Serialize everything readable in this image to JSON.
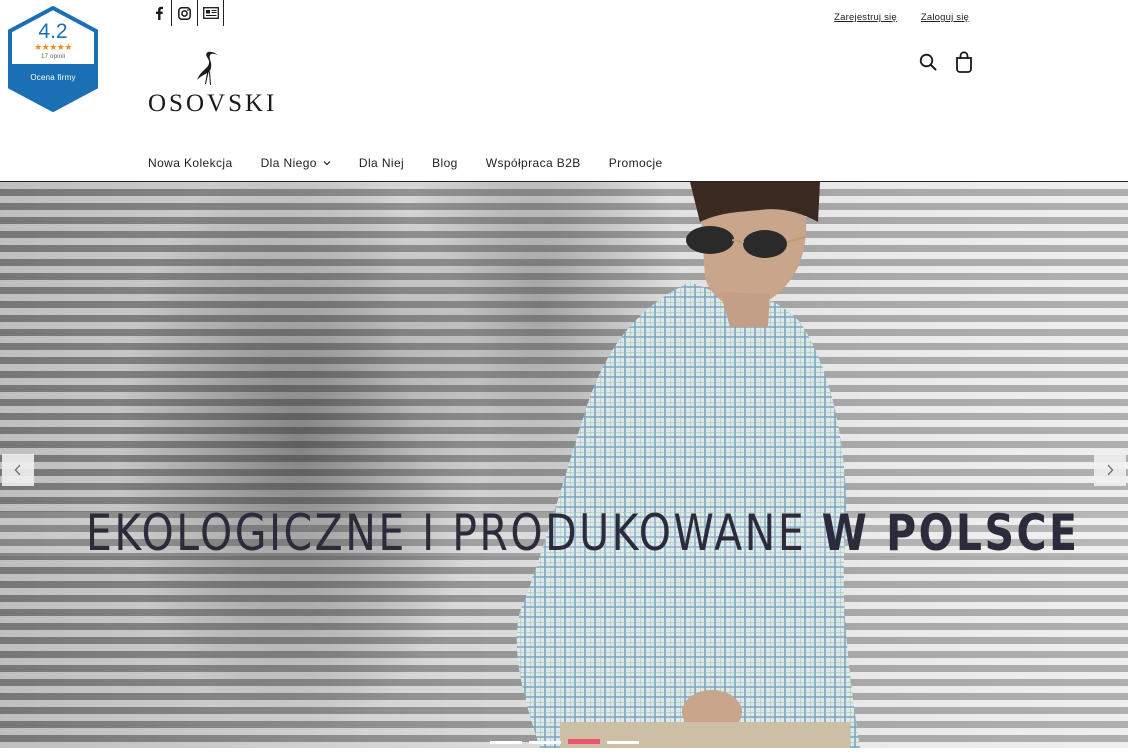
{
  "badge": {
    "score": "4.2",
    "stars": "★★★★★",
    "reviews": "17 opinii",
    "label": "Ocena firmy",
    "color": "#1b6fb5"
  },
  "social": [
    {
      "name": "facebook-icon"
    },
    {
      "name": "instagram-icon"
    },
    {
      "name": "newspaper-icon"
    }
  ],
  "account": {
    "register": "Zarejestruj się",
    "login": "Zaloguj się"
  },
  "logo": {
    "text": "OSOVSKI"
  },
  "tools": {
    "search_icon": "search-icon",
    "cart_icon": "shopping-bag-icon"
  },
  "nav": [
    {
      "label": "Nowa Kolekcja"
    },
    {
      "label": "Dla Niego",
      "has_dropdown": true
    },
    {
      "label": "Dla Niej"
    },
    {
      "label": "Blog"
    },
    {
      "label": "Współpraca B2B"
    },
    {
      "label": "Promocje"
    }
  ],
  "hero": {
    "headline_regular": "EKOLOGICZNE I PRODUKOWANE ",
    "headline_bold": "W POLSCE",
    "slide_count": 4,
    "active_slide": 3,
    "accent": "#e8566e"
  }
}
